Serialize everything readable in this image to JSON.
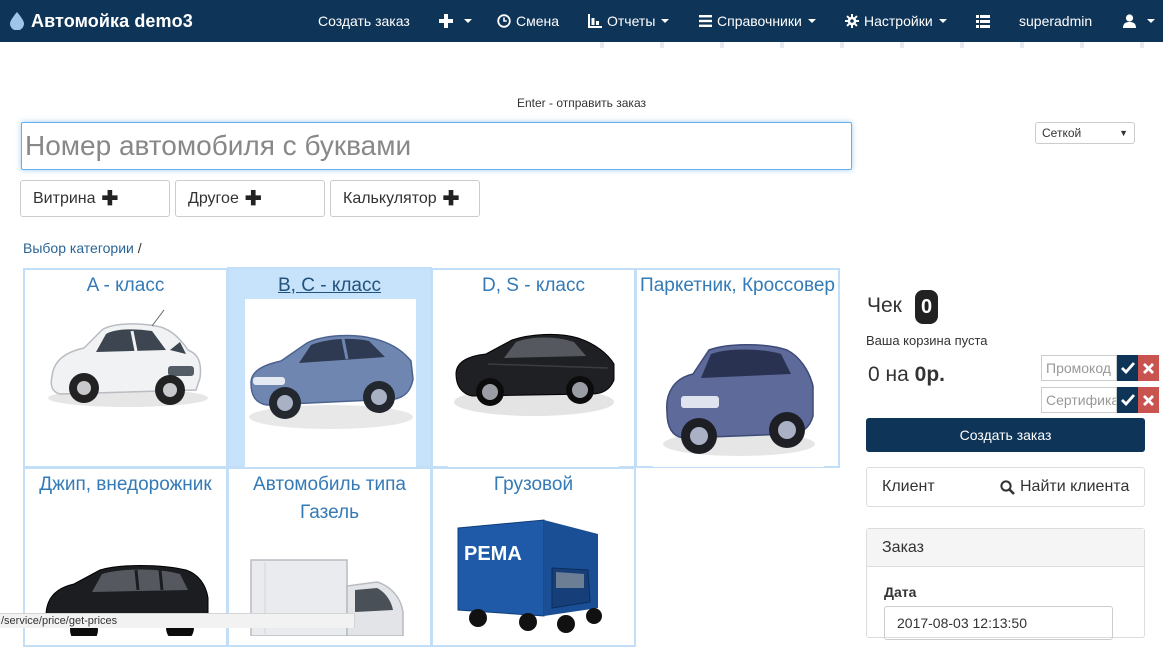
{
  "navbar": {
    "brand": "Автомойка demo3",
    "create_order": "Создать заказ",
    "shift": "Смена",
    "reports": "Отчеты",
    "references": "Справочники",
    "settings": "Настройки",
    "user": "superadmin"
  },
  "order_entry": {
    "hint": "Enter - отправить заказ",
    "plate_placeholder": "Номер автомобиля с буквами",
    "view_select": "Сеткой",
    "buttons": [
      "Витрина",
      "Другое",
      "Калькулятор"
    ]
  },
  "breadcrumb": {
    "label": "Выбор категории",
    "separator": "/"
  },
  "categories": [
    {
      "name": "A - класс"
    },
    {
      "name": "B, C - класс"
    },
    {
      "name": "D, S - класс"
    },
    {
      "name": "Паркетник, Кроссовер"
    },
    {
      "name": "Джип, внедорожник"
    },
    {
      "name": "Автомобиль типа Газель"
    },
    {
      "name": "Грузовой"
    }
  ],
  "cart": {
    "check_label": "Чек",
    "check_count": "0",
    "empty_text": "Ваша корзина пуста",
    "total_prefix": "0 на",
    "total_amount": "0р.",
    "promo_placeholder": "Промокод",
    "certificate_placeholder": "Сертификат",
    "create_order": "Создать заказ",
    "client_label": "Клиент",
    "find_client": "Найти клиента"
  },
  "order": {
    "title": "Заказ",
    "date_label": "Дата",
    "date_value": "2017-08-03 12:13:50"
  },
  "status_url": "/service/price/get-prices",
  "colors": {
    "navbar": "#0e3458",
    "link": "#337ab7",
    "category_border": "#c3def7",
    "category_active": "#c6e3fb",
    "danger": "#c9534e"
  }
}
